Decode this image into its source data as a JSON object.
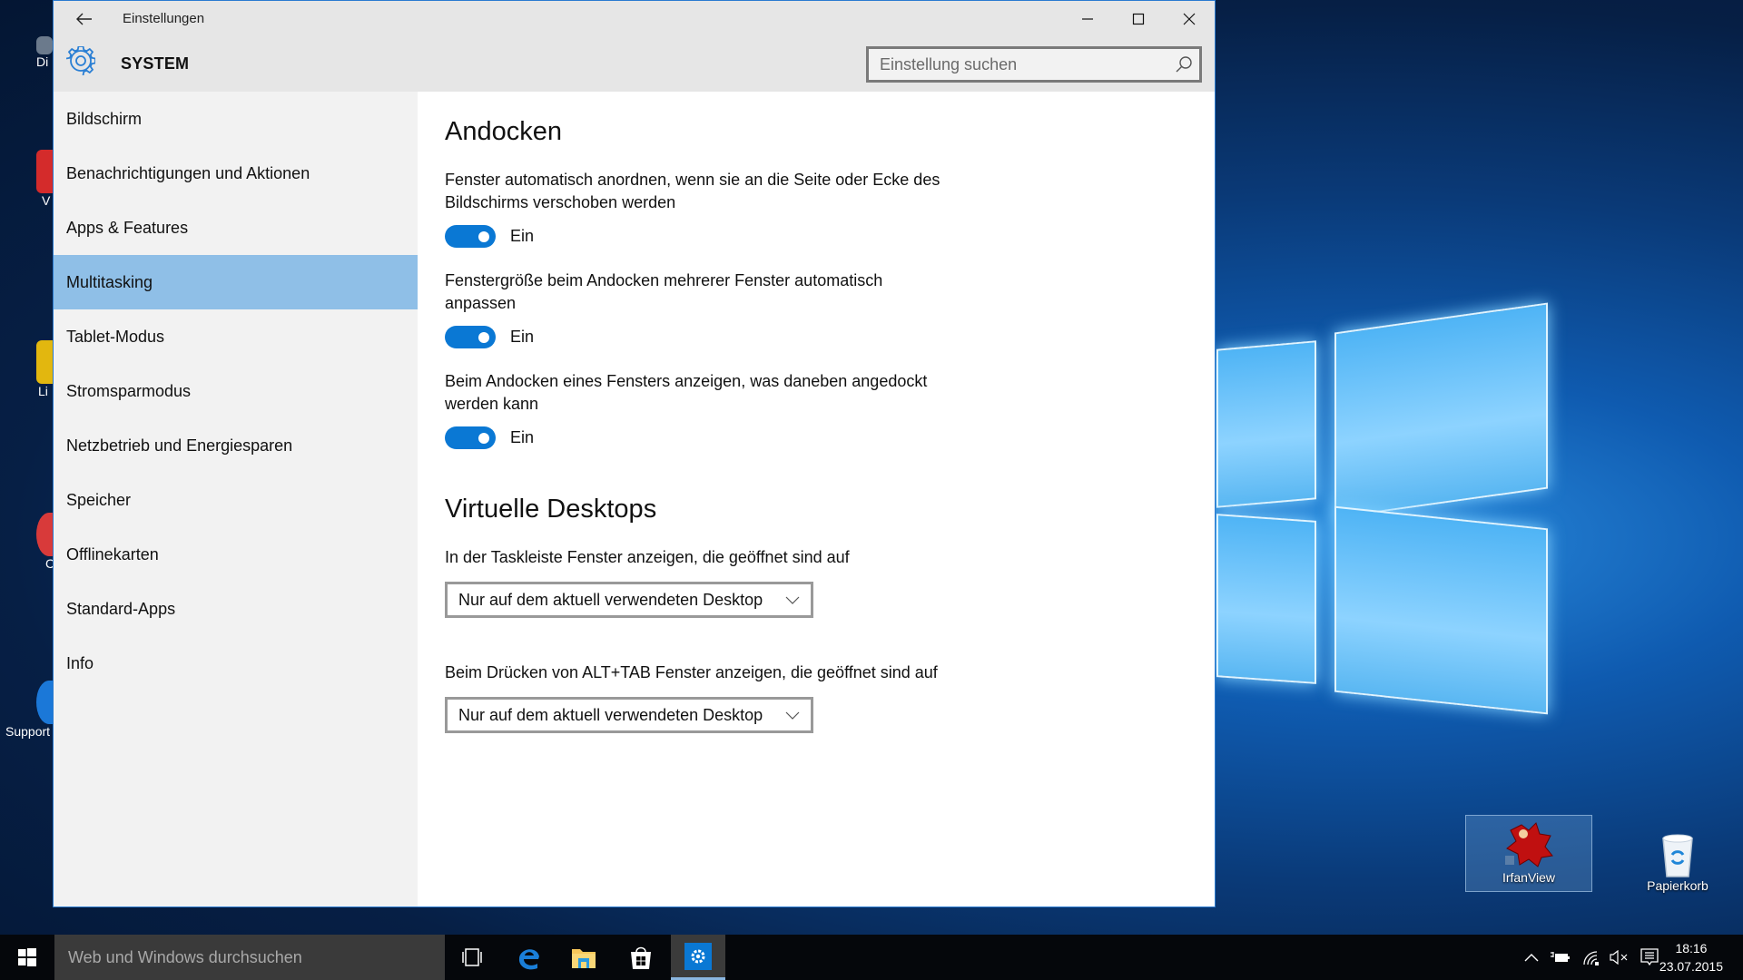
{
  "window": {
    "title": "Einstellungen",
    "section_title": "SYSTEM",
    "search_placeholder": "Einstellung suchen"
  },
  "sidebar": {
    "items": [
      {
        "label": "Bildschirm",
        "active": false
      },
      {
        "label": "Benachrichtigungen und Aktionen",
        "active": false
      },
      {
        "label": "Apps & Features",
        "active": false
      },
      {
        "label": "Multitasking",
        "active": true
      },
      {
        "label": "Tablet-Modus",
        "active": false
      },
      {
        "label": "Stromsparmodus",
        "active": false
      },
      {
        "label": "Netzbetrieb und Energiesparen",
        "active": false
      },
      {
        "label": "Speicher",
        "active": false
      },
      {
        "label": "Offlinekarten",
        "active": false
      },
      {
        "label": "Standard-Apps",
        "active": false
      },
      {
        "label": "Info",
        "active": false
      }
    ]
  },
  "content": {
    "snap": {
      "heading": "Andocken",
      "settings": [
        {
          "label": "Fenster automatisch anordnen, wenn sie an die Seite oder Ecke des Bildschirms verschoben werden",
          "state": "Ein",
          "on": true
        },
        {
          "label": "Fenstergröße beim Andocken mehrerer Fenster automatisch anpassen",
          "state": "Ein",
          "on": true
        },
        {
          "label": "Beim Andocken eines Fensters anzeigen, was daneben angedockt werden kann",
          "state": "Ein",
          "on": true
        }
      ]
    },
    "virtual_desktops": {
      "heading": "Virtuelle Desktops",
      "settings": [
        {
          "label": "In der Taskleiste Fenster anzeigen, die geöffnet sind auf",
          "value": "Nur auf dem aktuell verwendeten Desktop"
        },
        {
          "label": "Beim Drücken von ALT+TAB Fenster anzeigen, die geöffnet sind auf",
          "value": "Nur auf dem aktuell verwendeten Desktop"
        }
      ]
    }
  },
  "desktop": {
    "left_icons": [
      {
        "label": "Di",
        "color": "#6b7a8c"
      },
      {
        "label": "V",
        "color": "#d42b2b"
      },
      {
        "label": "Li",
        "color": "#e2b70f"
      },
      {
        "label": "C",
        "color": "#d83a3a"
      },
      {
        "label": "Support",
        "color": "#1b78d8"
      }
    ],
    "right_icons": [
      {
        "label": "IrfanView",
        "selected": true
      },
      {
        "label": "Papierkorb",
        "selected": false
      }
    ]
  },
  "taskbar": {
    "search_placeholder": "Web und Windows durchsuchen",
    "apps": [
      "task-view",
      "edge",
      "file-explorer",
      "store",
      "settings"
    ],
    "active_app": "settings",
    "time": "18:16",
    "date": "23.07.2015"
  },
  "colors": {
    "accent": "#0a78d4",
    "selection": "#8fbfe7"
  }
}
